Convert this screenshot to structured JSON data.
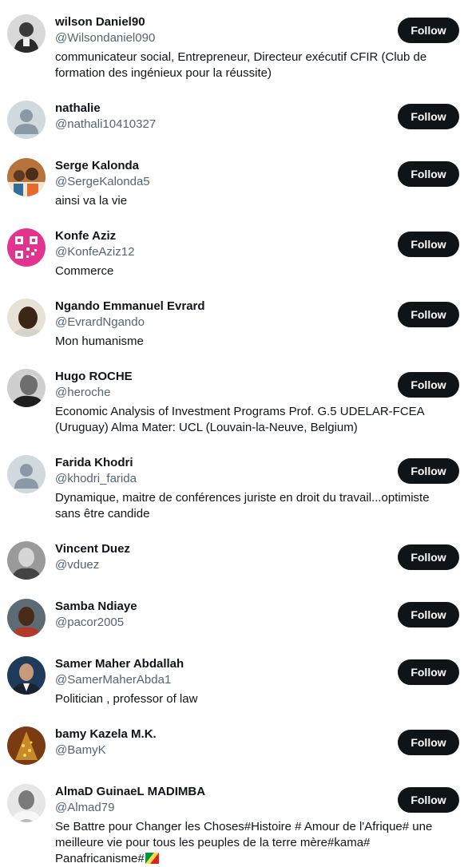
{
  "follow_label": "Follow",
  "colors": {
    "button_bg": "#0f1419",
    "handle_gray": "#536471",
    "default_avatar_bg": "#cfd9de"
  },
  "users": [
    {
      "name": "wilson Daniel90",
      "handle": "@Wilsondaniel090",
      "bio": "communicateur social, Entrepreneur, Directeur exécutif CFIR (Club de formation des ingénieux pour la réussite)",
      "avatar": "bw-portrait"
    },
    {
      "name": "nathalie",
      "handle": "@nathali10410327",
      "bio": "",
      "avatar": "default-avatar"
    },
    {
      "name": "Serge Kalonda",
      "handle": "@SergeKalonda5",
      "bio": "ainsi va la vie",
      "avatar": "group-photo"
    },
    {
      "name": "Konfe Aziz",
      "handle": "@KonfeAziz12",
      "bio": "Commerce",
      "avatar": "qr-code-pink"
    },
    {
      "name": "Ngando Emmanuel Evrard",
      "handle": "@EvrardNgando",
      "bio": "Mon humanisme",
      "avatar": "portrait"
    },
    {
      "name": "Hugo ROCHE",
      "handle": "@heroche",
      "bio": "Economic Analysis of Investment Programs Prof. G.5 UDELAR-FCEA (Uruguay) Alma Mater: UCL (Louvain-la-Neuve, Belgium)",
      "avatar": "bw-portrait"
    },
    {
      "name": "Farida Khodri",
      "handle": "@khodri_farida",
      "bio": "Dynamique, maitre de conférences juriste en droit du travail...optimiste sans être candide",
      "avatar": "default-avatar"
    },
    {
      "name": "Vincent Duez",
      "handle": "@vduez",
      "bio": "",
      "avatar": "bw-portrait"
    },
    {
      "name": "Samba Ndiaye",
      "handle": "@pacor2005",
      "bio": "",
      "avatar": "portrait"
    },
    {
      "name": "Samer Maher Abdallah",
      "handle": "@SamerMaherAbda1",
      "bio": "Politician , professor of law",
      "avatar": "portrait-suit"
    },
    {
      "name": "bamy Kazela M.K.",
      "handle": "@BamyK",
      "bio": "",
      "avatar": "christmas-tree"
    },
    {
      "name": "AlmaD GuinaeL MADIMBA",
      "handle": "@Almad79",
      "bio": "Se Battre pour Changer les Choses#Histoire # Amour de l'Afrique# une meilleure vie pour tous les peuples de la terre mère#kama# Panafricanisme#",
      "bio_emoji": "flag-congo",
      "avatar": "bw-portrait"
    }
  ]
}
